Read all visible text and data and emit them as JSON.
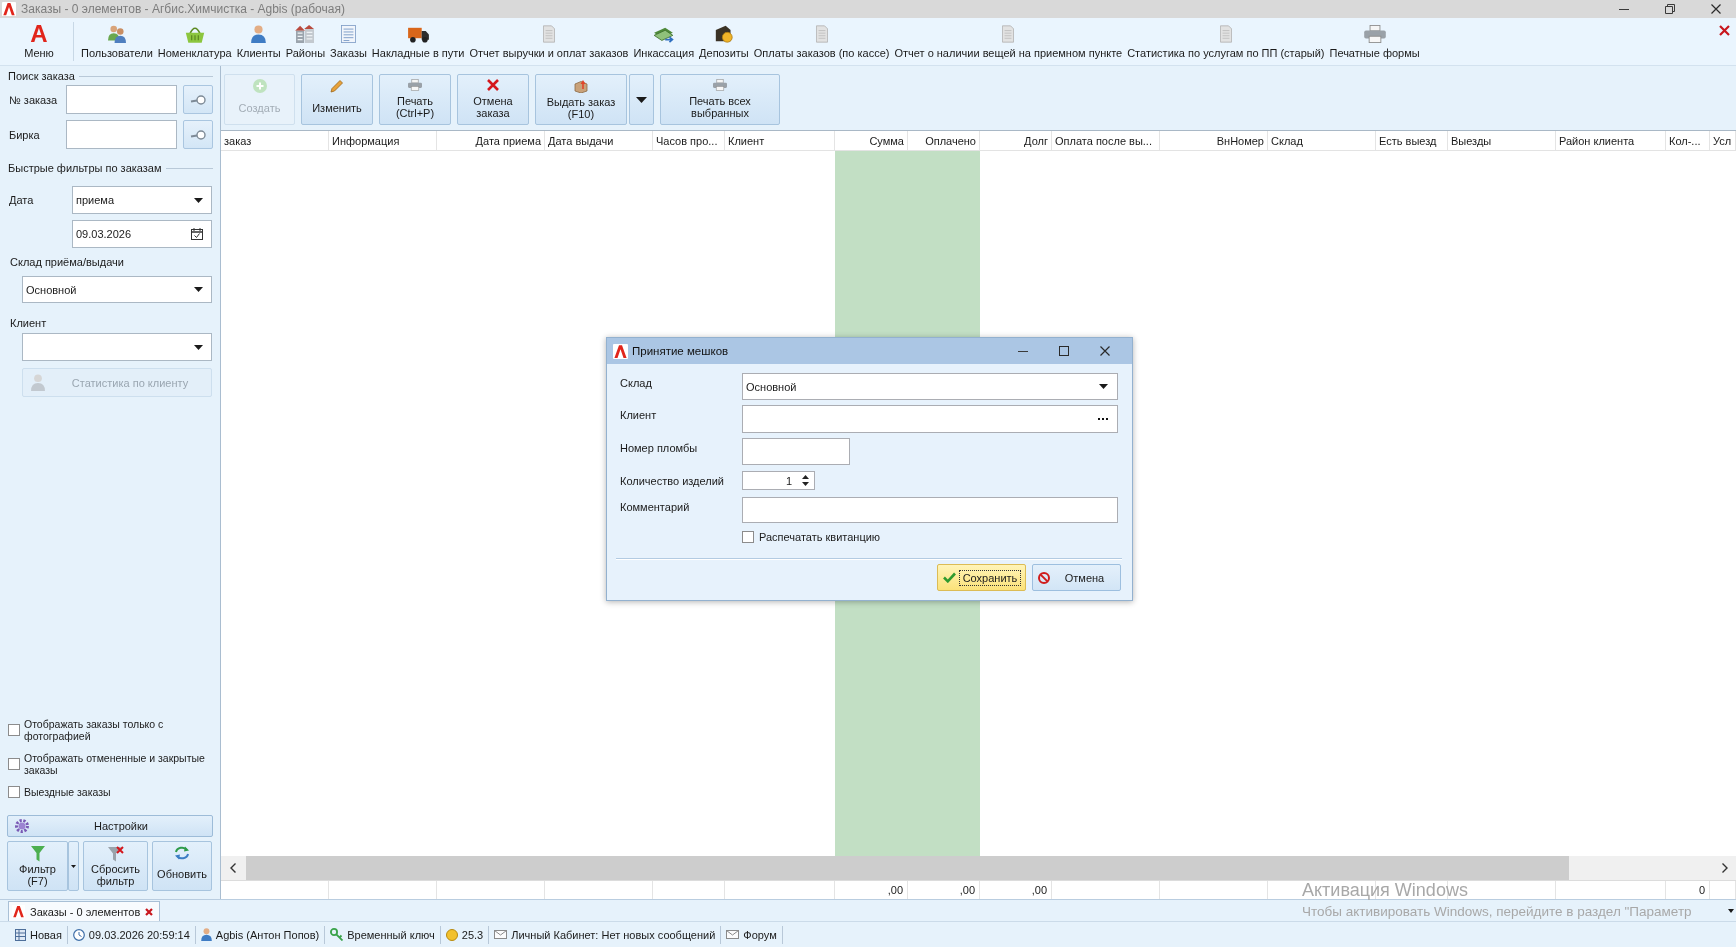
{
  "window": {
    "title": "Заказы - 0 элементов - Агбис.Химчистка - Agbis (рабочая)"
  },
  "ribbon": {
    "menu": {
      "logo": "A",
      "label": "Меню"
    },
    "items": [
      {
        "label": "Пользователи"
      },
      {
        "label": "Номенклатура"
      },
      {
        "label": "Клиенты"
      },
      {
        "label": "Районы"
      },
      {
        "label": "Заказы"
      },
      {
        "label": "Накладные в пути"
      },
      {
        "label": "Отчет выручки и оплат заказов"
      },
      {
        "label": "Инкассация"
      },
      {
        "label": "Депозиты"
      },
      {
        "label": "Оплаты заказов (по кассе)"
      },
      {
        "label": "Отчет о наличии вещей на приемном пункте"
      },
      {
        "label": "Статистика по услугам по ПП (старый)"
      },
      {
        "label": "Печатные формы"
      }
    ]
  },
  "search_panel": {
    "title": "Поиск заказа",
    "fields": [
      {
        "label": "№ заказа"
      },
      {
        "label": "Бирка"
      }
    ]
  },
  "quick_filters": {
    "title": "Быстрые фильтры по заказам",
    "date": {
      "label": "Дата",
      "mode": "приема",
      "value": "09.03.2026"
    },
    "warehouse": {
      "label": "Склад приёма/выдачи",
      "value": "Основной"
    },
    "client": {
      "label": "Клиент"
    },
    "client_stats_button": {
      "label": "Статистика по клиенту",
      "disabled": true
    }
  },
  "options": [
    {
      "label": "Отображать заказы только с фотографией",
      "checked": false
    },
    {
      "label": "Отображать отмененные и закрытые заказы",
      "checked": false
    },
    {
      "label": "Выездные заказы",
      "checked": false
    }
  ],
  "settings_button": {
    "label": "Настройки"
  },
  "filter_buttons": [
    {
      "label_lines": [
        "Фильтр",
        "(F7)"
      ],
      "kind": "split"
    },
    {
      "label_lines": [
        "Сбросить",
        "фильтр"
      ],
      "kind": "button"
    },
    {
      "label_lines": [
        "Обновить"
      ],
      "kind": "button"
    }
  ],
  "toolbar": [
    {
      "label_lines": [
        "Создать"
      ],
      "disabled": true,
      "kind": "button"
    },
    {
      "label_lines": [
        "Изменить"
      ],
      "disabled": false,
      "kind": "button"
    },
    {
      "label_lines": [
        "Печать",
        "(Ctrl+P)"
      ],
      "disabled": false,
      "kind": "button"
    },
    {
      "label_lines": [
        "Отмена",
        "заказа"
      ],
      "disabled": false,
      "kind": "button"
    },
    {
      "label_lines": [
        "Выдать заказ",
        "(F10)"
      ],
      "disabled": false,
      "kind": "split"
    },
    {
      "label_lines": [
        "Печать всех",
        "выбранных"
      ],
      "disabled": false,
      "kind": "button"
    }
  ],
  "table": {
    "columns": [
      {
        "label": "заказ",
        "highlighted": false
      },
      {
        "label": "Информация",
        "highlighted": false
      },
      {
        "label": "Дата приема",
        "highlighted": false
      },
      {
        "label": "Дата выдачи",
        "highlighted": false
      },
      {
        "label": "Часов про...",
        "highlighted": false
      },
      {
        "label": "Клиент",
        "highlighted": false
      },
      {
        "label": "Сумма",
        "highlighted": true,
        "total": ",00"
      },
      {
        "label": "Оплачено",
        "highlighted": true,
        "total": ",00"
      },
      {
        "label": "Долг",
        "highlighted": false,
        "total": ",00"
      },
      {
        "label": "Оплата после вы...",
        "highlighted": false
      },
      {
        "label": "ВнНомер",
        "highlighted": false
      },
      {
        "label": "Склад",
        "highlighted": false
      },
      {
        "label": "Есть выезд",
        "highlighted": false
      },
      {
        "label": "Выезды",
        "highlighted": false
      },
      {
        "label": "Район клиента",
        "highlighted": false
      },
      {
        "label": "Кол-...",
        "highlighted": false,
        "total": "0"
      },
      {
        "label": "Усл",
        "highlighted": false
      }
    ]
  },
  "tabs": [
    {
      "label": "Заказы - 0 элементов",
      "selected": true
    }
  ],
  "status_bar": [
    {
      "text": "Новая"
    },
    {
      "text": "09.03.2026 20:59:14"
    },
    {
      "text": "Agbis (Антон Попов)"
    },
    {
      "text": "Временный ключ"
    },
    {
      "text": "25.3"
    },
    {
      "text": "Личный Кабинет: Нет новых сообщений"
    },
    {
      "text": "Форум"
    }
  ],
  "dialog": {
    "title": "Принятие мешков",
    "fields": [
      {
        "kind": "select",
        "label": "Склад",
        "value": "Основной"
      },
      {
        "kind": "lookup",
        "label": "Клиент"
      },
      {
        "kind": "text",
        "label": "Номер пломбы"
      },
      {
        "kind": "spin",
        "label": "Количество изделий",
        "value": "1"
      },
      {
        "kind": "text",
        "label": "Комментарий"
      }
    ],
    "print_receipt": {
      "label": "Распечатать квитанцию",
      "checked": false
    },
    "buttons": [
      {
        "kind": "save",
        "label": "Сохранить",
        "focused": true
      },
      {
        "kind": "cancel",
        "label": "Отмена",
        "focused": false
      }
    ]
  },
  "os_watermark": {
    "title": "Активация Windows",
    "message": "Чтобы активировать Windows, перейдите в раздел \"Параметр"
  }
}
